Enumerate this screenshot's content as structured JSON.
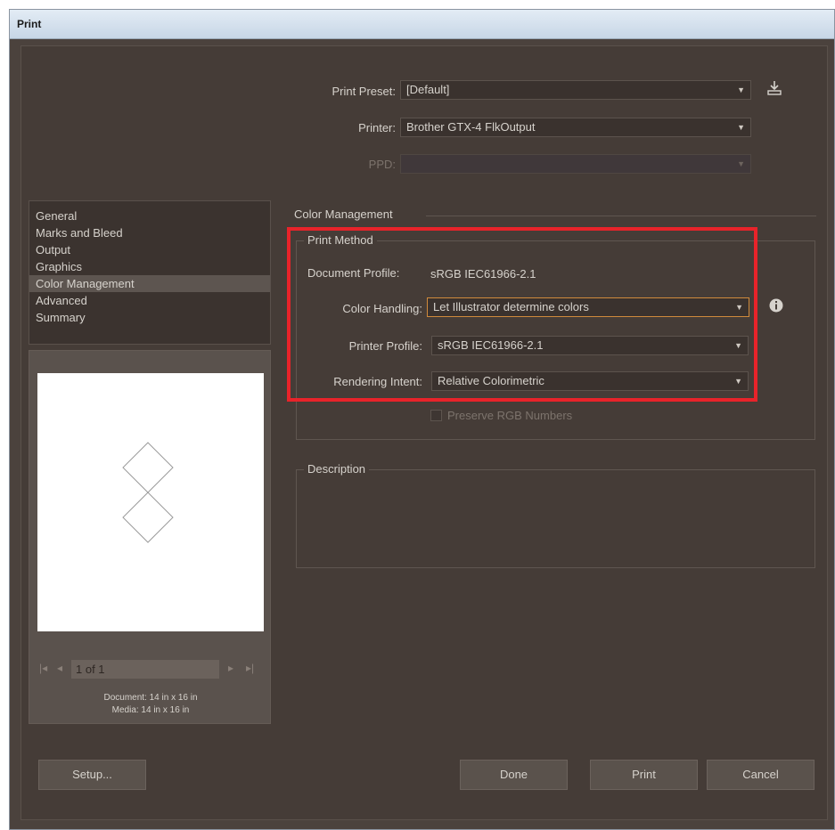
{
  "window": {
    "title": "Print"
  },
  "top": {
    "print_preset": {
      "label": "Print Preset:",
      "value": "[Default]"
    },
    "printer": {
      "label": "Printer:",
      "value": "Brother GTX-4 FlkOutput"
    },
    "ppd": {
      "label": "PPD:",
      "value": ""
    }
  },
  "categories": [
    {
      "label": "General",
      "selected": false
    },
    {
      "label": "Marks and Bleed",
      "selected": false
    },
    {
      "label": "Output",
      "selected": false
    },
    {
      "label": "Graphics",
      "selected": false
    },
    {
      "label": "Color Management",
      "selected": true
    },
    {
      "label": "Advanced",
      "selected": false
    },
    {
      "label": "Summary",
      "selected": false
    }
  ],
  "preview": {
    "page": "1 of 1",
    "document_size": "Document: 14 in x 16 in",
    "media_size": "Media: 14 in x 16 in"
  },
  "color_management": {
    "heading": "Color Management",
    "print_method_label": "Print Method",
    "document_profile_label": "Document Profile:",
    "document_profile_value": "sRGB IEC61966-2.1",
    "color_handling": {
      "label": "Color Handling:",
      "value": "Let Illustrator determine colors"
    },
    "printer_profile": {
      "label": "Printer Profile:",
      "value": "sRGB IEC61966-2.1"
    },
    "rendering_intent": {
      "label": "Rendering Intent:",
      "value": "Relative Colorimetric"
    },
    "preserve_rgb": {
      "label": "Preserve RGB Numbers",
      "checked": false,
      "enabled": false
    }
  },
  "description": {
    "label": "Description",
    "text": ""
  },
  "buttons": {
    "setup": "Setup...",
    "done": "Done",
    "print": "Print",
    "cancel": "Cancel"
  },
  "colors": {
    "highlight": "#e8232a",
    "dialog_bg": "#453c37",
    "focus": "#d08a3c"
  },
  "icons": {
    "preset_save": "save-preset-icon",
    "info": "info-icon",
    "pager_first": "first-page-icon",
    "pager_prev": "previous-page-icon",
    "pager_next": "next-page-icon",
    "pager_last": "last-page-icon"
  }
}
